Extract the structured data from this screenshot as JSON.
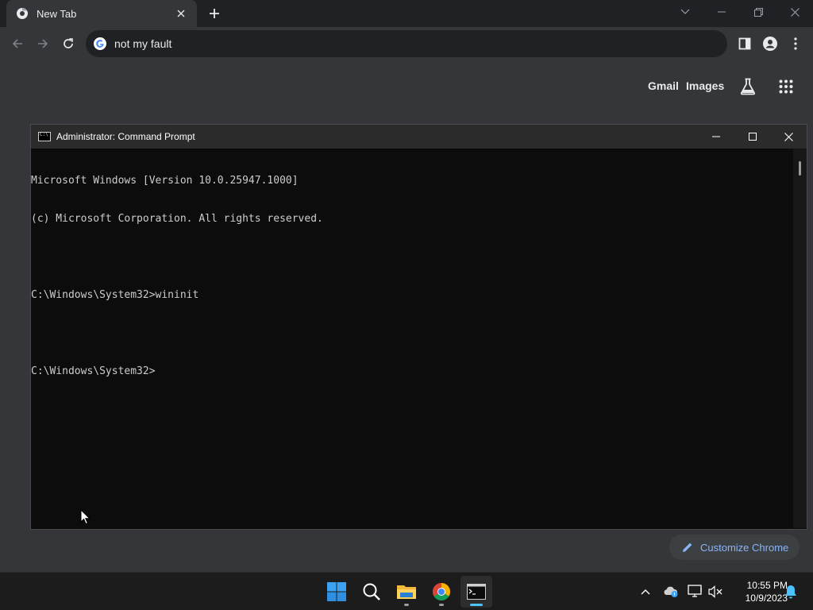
{
  "browser": {
    "tab": {
      "title": "New Tab",
      "favicon": "chrome-icon"
    },
    "new_tab_icon": "plus-icon",
    "omnibox": {
      "text": "not my fault",
      "icon": "google-g-icon"
    },
    "ntp": {
      "gmail_label": "Gmail",
      "images_label": "Images",
      "customize_label": "Customize Chrome"
    }
  },
  "cmd": {
    "title": "Administrator: Command Prompt",
    "lines": [
      "Microsoft Windows [Version 10.0.25947.1000]",
      "(c) Microsoft Corporation. All rights reserved.",
      "",
      "C:\\Windows\\System32>wininit",
      "",
      "C:\\Windows\\System32>"
    ]
  },
  "taskbar": {
    "apps": [
      "windows-start-icon",
      "search-icon",
      "file-explorer-icon",
      "chrome-icon",
      "terminal-icon"
    ],
    "clock": {
      "time": "10:55 PM",
      "date": "10/9/2023"
    }
  },
  "colors": {
    "chrome_frame": "#202124",
    "chrome_toolbar": "#35363a",
    "link_blue": "#8ab4f8",
    "console_bg": "#0c0c0c",
    "console_text": "#cccccc",
    "taskbar_accent": "#4cc2ff"
  }
}
